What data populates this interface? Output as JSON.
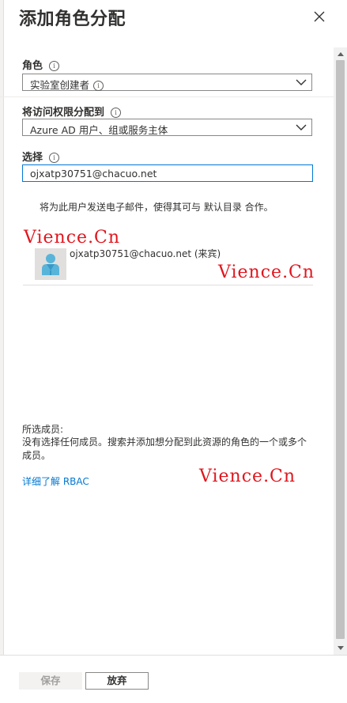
{
  "panel": {
    "title": "添加角色分配"
  },
  "role": {
    "label": "角色",
    "value": "实验室创建者",
    "value_has_info_icon": true
  },
  "assign_access": {
    "label": "将访问权限分配到",
    "value": "Azure AD 用户、组或服务主体"
  },
  "select": {
    "label": "选择",
    "value": "ojxatp30751@chacuo.net",
    "notice": "将为此用户发送电子邮件，使得其可与 默认目录 合作。"
  },
  "search_result": {
    "name": "ojxatp30751@chacuo.net (来宾)",
    "avatar_icon": "guest-user-icon"
  },
  "watermarks": [
    "Vience.Cn",
    "Vience.Cn",
    "Vience.Cn"
  ],
  "selected_members": {
    "label": "所选成员:",
    "description": "没有选择任何成员。搜索并添加想分配到此资源的角色的一个或多个成员。"
  },
  "learn_more": {
    "label": "详细了解 RBAC"
  },
  "footer": {
    "save_label": "保存",
    "discard_label": "放弃"
  },
  "colors": {
    "accent": "#0078d4",
    "watermark": "#e0161e",
    "text": "#323130"
  }
}
